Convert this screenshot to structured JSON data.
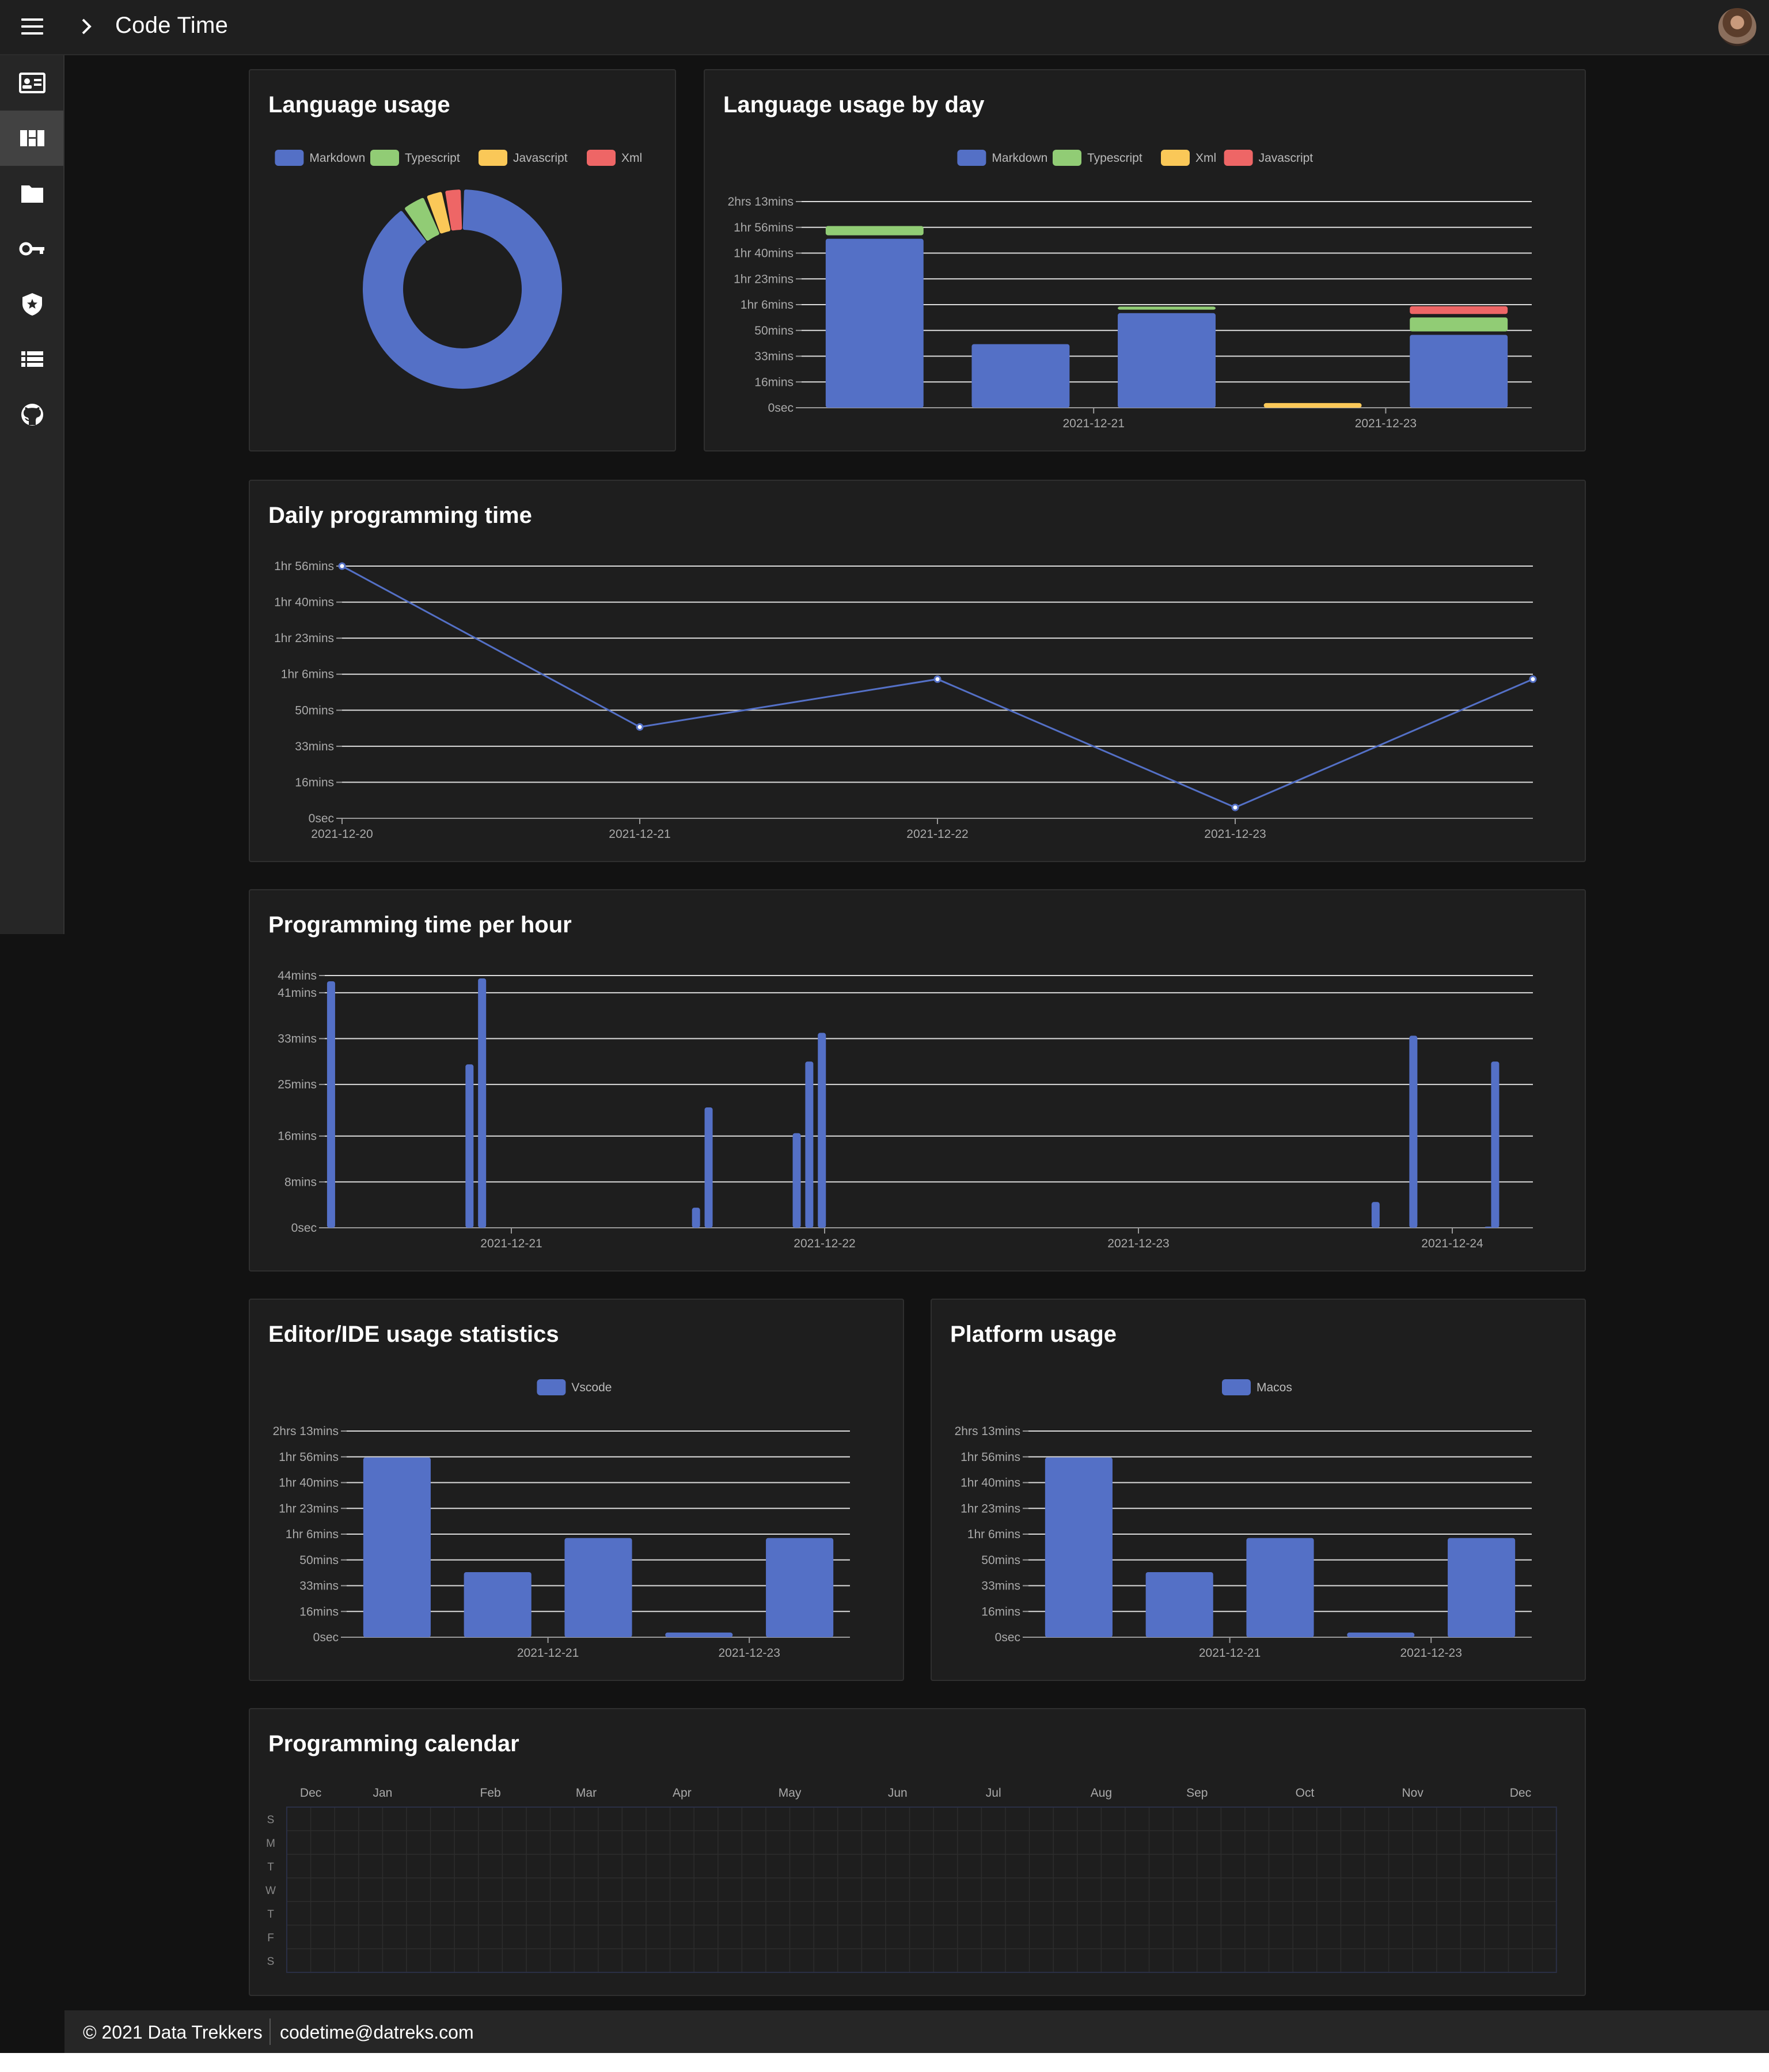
{
  "app": {
    "title": "Code Time"
  },
  "sidebar": {
    "items": [
      {
        "icon": "profile-card-icon"
      },
      {
        "icon": "dashboard-icon",
        "active": true
      },
      {
        "icon": "folder-icon"
      },
      {
        "icon": "key-icon"
      },
      {
        "icon": "shield-icon"
      },
      {
        "icon": "list-icon"
      },
      {
        "icon": "github-icon"
      }
    ]
  },
  "colors": {
    "markdown": "#5470c6",
    "typescript": "#91cc75",
    "javascript_yellow": "#fac858",
    "xml_red": "#ee6666",
    "background": "#121212",
    "card": "#1e1e1e"
  },
  "cards": {
    "language_usage": {
      "title": "Language usage"
    },
    "language_by_day": {
      "title": "Language usage by day"
    },
    "daily_time": {
      "title": "Daily programming time"
    },
    "per_hour": {
      "title": "Programming time per hour"
    },
    "editor": {
      "title": "Editor/IDE usage statistics"
    },
    "platform": {
      "title": "Platform usage"
    },
    "calendar": {
      "title": "Programming calendar"
    }
  },
  "chart_data": [
    {
      "id": "language_usage",
      "type": "pie",
      "legend": [
        "Markdown",
        "Typescript",
        "Javascript",
        "Xml"
      ],
      "legend_colors": [
        "#5470c6",
        "#91cc75",
        "#fac858",
        "#ee6666"
      ],
      "values": [
        88,
        4,
        3,
        3
      ]
    },
    {
      "id": "language_by_day",
      "type": "bar",
      "stacked": true,
      "legend": [
        "Markdown",
        "Typescript",
        "Xml",
        "Javascript"
      ],
      "legend_colors": [
        "#5470c6",
        "#91cc75",
        "#fac858",
        "#ee6666"
      ],
      "y_ticks": [
        "0sec",
        "16mins",
        "33mins",
        "50mins",
        "1hr 6mins",
        "1hr 23mins",
        "1hr 40mins",
        "1hr 56mins",
        "2hrs 13mins"
      ],
      "ylim": [
        0,
        133
      ],
      "categories": [
        "2021-12-20",
        "2021-12-21",
        "2021-12-22",
        "2021-12-23",
        "2021-12-24"
      ],
      "x_tick_labels": [
        "",
        "2021-12-21",
        "",
        "2021-12-23",
        ""
      ],
      "series": [
        {
          "name": "Markdown",
          "values": [
            109,
            41,
            61,
            0,
            47
          ]
        },
        {
          "name": "Typescript",
          "values": [
            6,
            0,
            2,
            0,
            9
          ]
        },
        {
          "name": "Xml",
          "values": [
            0,
            0,
            0,
            3,
            0
          ]
        },
        {
          "name": "Javascript",
          "values": [
            0,
            0,
            0,
            0,
            5
          ]
        }
      ]
    },
    {
      "id": "daily_time",
      "type": "line",
      "y_ticks": [
        "0sec",
        "16mins",
        "33mins",
        "50mins",
        "1hr 6mins",
        "1hr 23mins",
        "1hr 40mins",
        "1hr 56mins"
      ],
      "ylim": [
        0,
        116
      ],
      "x": [
        "2021-12-20",
        "2021-12-21",
        "2021-12-22",
        "2021-12-23",
        "2021-12-24"
      ],
      "x_tick_labels": [
        "2021-12-20",
        "2021-12-21",
        "2021-12-22",
        "2021-12-23",
        ""
      ],
      "values": [
        116,
        42,
        64,
        5,
        64
      ]
    },
    {
      "id": "per_hour",
      "type": "bar",
      "y_ticks": [
        "0sec",
        "8mins",
        "16mins",
        "25mins",
        "33mins",
        "41mins",
        "44mins"
      ],
      "y_tick_values": [
        0,
        8,
        16,
        25,
        33,
        41,
        44
      ],
      "ylim": [
        0,
        44
      ],
      "x_tick_labels": [
        "2021-12-21",
        "2021-12-22",
        "2021-12-23",
        "2021-12-24"
      ],
      "x_range_hours": [
        0,
        96
      ],
      "x_tick_hours": [
        27,
        51,
        75,
        99
      ],
      "bars": [
        {
          "hour": 0,
          "value": 43
        },
        {
          "hour": 11,
          "value": 28.5
        },
        {
          "hour": 12,
          "value": 43.5
        },
        {
          "hour": 29,
          "value": 3.5
        },
        {
          "hour": 30,
          "value": 21
        },
        {
          "hour": 37,
          "value": 16.5
        },
        {
          "hour": 38,
          "value": 29
        },
        {
          "hour": 39,
          "value": 34
        },
        {
          "hour": 83,
          "value": 4.5
        },
        {
          "hour": 86,
          "value": 33.5
        },
        {
          "hour": 92,
          "value": 0.2
        },
        {
          "hour": 92.5,
          "value": 29
        }
      ]
    },
    {
      "id": "editor",
      "type": "bar",
      "legend": [
        "Vscode"
      ],
      "legend_colors": [
        "#5470c6"
      ],
      "y_ticks": [
        "0sec",
        "16mins",
        "33mins",
        "50mins",
        "1hr 6mins",
        "1hr 23mins",
        "1hr 40mins",
        "1hr 56mins",
        "2hrs 13mins"
      ],
      "ylim": [
        0,
        133
      ],
      "categories": [
        "2021-12-20",
        "2021-12-21",
        "2021-12-22",
        "2021-12-23",
        "2021-12-24"
      ],
      "x_tick_labels": [
        "",
        "2021-12-21",
        "",
        "2021-12-23",
        ""
      ],
      "values": [
        116,
        42,
        64,
        3,
        64
      ]
    },
    {
      "id": "platform",
      "type": "bar",
      "legend": [
        "Macos"
      ],
      "legend_colors": [
        "#5470c6"
      ],
      "y_ticks": [
        "0sec",
        "16mins",
        "33mins",
        "50mins",
        "1hr 6mins",
        "1hr 23mins",
        "1hr 40mins",
        "1hr 56mins",
        "2hrs 13mins"
      ],
      "ylim": [
        0,
        133
      ],
      "categories": [
        "2021-12-20",
        "2021-12-21",
        "2021-12-22",
        "2021-12-23",
        "2021-12-24"
      ],
      "x_tick_labels": [
        "",
        "2021-12-21",
        "",
        "2021-12-23",
        ""
      ],
      "values": [
        116,
        42,
        64,
        3,
        64
      ]
    },
    {
      "id": "calendar",
      "type": "heatmap",
      "months": [
        "Dec",
        "Jan",
        "Feb",
        "Mar",
        "Apr",
        "May",
        "Jun",
        "Jul",
        "Aug",
        "Sep",
        "Oct",
        "Nov",
        "Dec"
      ],
      "month_week_index": [
        1,
        4,
        8.5,
        12.5,
        16.5,
        21,
        25.5,
        29.5,
        34,
        38,
        42.5,
        47,
        51.5
      ],
      "weekday_labels": [
        "S",
        "M",
        "T",
        "W",
        "T",
        "F",
        "S"
      ],
      "weeks": 53
    }
  ],
  "footer": {
    "copyright": "© 2021 Data Trekkers",
    "email": "codetime@datreks.com"
  }
}
